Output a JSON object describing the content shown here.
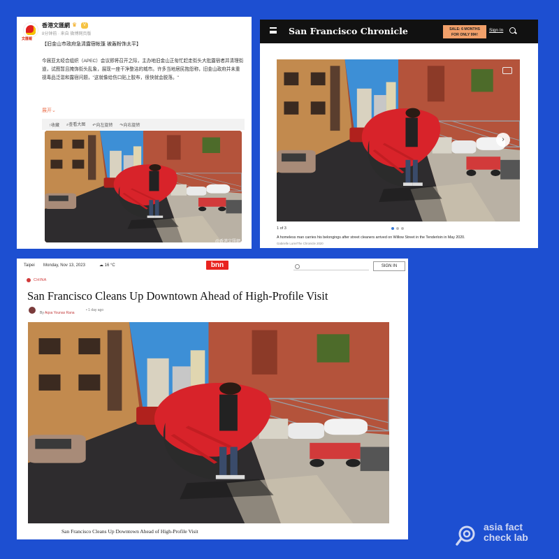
{
  "weibo": {
    "logo_text": "文匯報",
    "account_name": "香港文匯網",
    "badge": "V",
    "meta": "8分钟前 · 来自 微博网页版",
    "headline": "【旧金山市政府急清露宿帐篷 被轰粉饰太平】",
    "body": "今届亚太经合组织（APEC）会议即将召开之际，主办地旧金山正匆忙赶走街头大批露宿者并清理街道，试图暂且掩饰街头乱象，展现一座干净整洁的城市。许多当地居民抱怨称，旧金山政府并未重视毒品泛滥和露宿问题，\"这就像给伤口贴上胶布，很快就会脱落。\"",
    "expand": "展开",
    "tools": [
      "收藏",
      "查看大图",
      "向左旋转",
      "向右旋转"
    ],
    "watermark": "@香港文匯網"
  },
  "chronicle": {
    "masthead": "San Francisco Chronicle",
    "sale_line1": "SALE: 6 MONTHS",
    "sale_line2": "FOR ONLY 99¢!",
    "signin": "Sign In",
    "counter": "1 of 3",
    "caption": "A homeless man carries his belongings after street cleaners arrived on Willow Street in the Tenderloin in May 2020.",
    "credit": "Gabrielle Lurie/The Chronicle 2020",
    "next_arrow": "›"
  },
  "bnn": {
    "city": "Taipei",
    "date": "Monday, Nov 13, 2023",
    "weather": "16 °C",
    "logo": "bnn",
    "signin": "SIGN IN",
    "category": "CHINA",
    "headline": "San Francisco Cleans Up Downtown Ahead of High-Profile Visit",
    "by_prefix": "By",
    "author": "Aqsa Younas Rana",
    "time_ago": "1 day ago",
    "image_caption": "San Francisco Cleans Up Downtown Ahead of High-Profile Visit"
  },
  "brand": {
    "line1": "asia fact",
    "line2": "check lab"
  }
}
